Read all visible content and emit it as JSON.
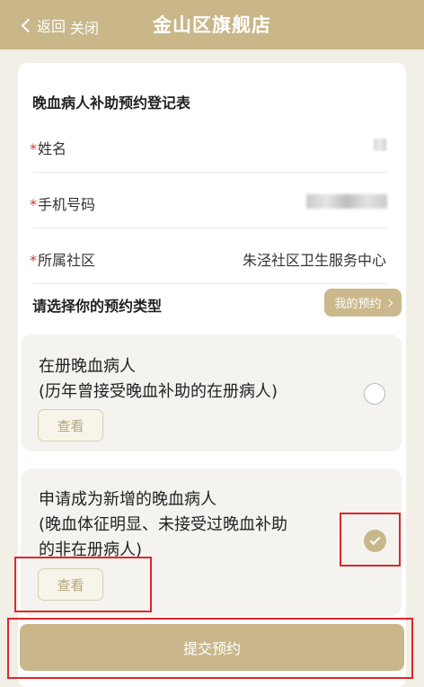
{
  "header": {
    "back_label": "返回",
    "close_label": "关闭",
    "title": "金山区旗舰店"
  },
  "form": {
    "title": "晚血病人补助预约登记表",
    "required_mark": "*",
    "fields": [
      {
        "label": "姓名",
        "value": ""
      },
      {
        "label": "手机号码",
        "value": ""
      },
      {
        "label": "所属社区",
        "value": "朱泾社区卫生服务中心"
      }
    ]
  },
  "appointment": {
    "section_title": "请选择你的预约类型",
    "my_appointment_label": "我的预约",
    "options": [
      {
        "lines": [
          "在册晚血病人",
          "(历年曾接受晚血补助的在册病人)"
        ],
        "view_label": "查看",
        "selected": false
      },
      {
        "lines": [
          "申请成为新增的晚血病人",
          "(晚血体征明显、未接受过晚血补助",
          "的非在册病人)"
        ],
        "view_label": "查看",
        "selected": true
      }
    ]
  },
  "submit_label": "提交预约",
  "colors": {
    "accent": "#c9b78a",
    "required": "#d43a2f",
    "highlight": "#e0262a"
  }
}
